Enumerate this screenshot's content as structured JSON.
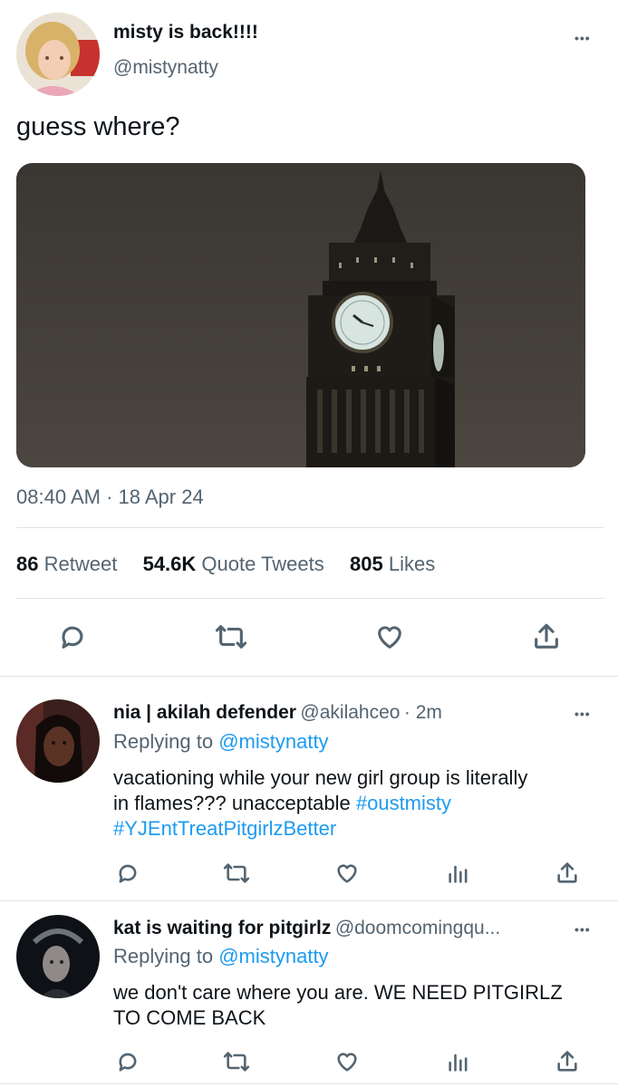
{
  "main_tweet": {
    "display_name": "misty is back!!!!",
    "handle": "@mistynatty",
    "text": "guess where?",
    "timestamp": "08:40 AM · 18 Apr 24",
    "stats": {
      "retweets_count": "86",
      "retweets_label": "Retweet",
      "quotes_count": "54.6K",
      "quotes_label": "Quote Tweets",
      "likes_count": "805",
      "likes_label": "Likes"
    }
  },
  "replies": [
    {
      "display_name": "nia | akilah defender",
      "handle": "@akilahceo",
      "time": "· 2m",
      "replying_to_label": "Replying to",
      "replying_to_handle": "@mistynatty",
      "text_line1": "vacationing while your new girl group is literally",
      "text_line2_plain": "in flames??? unacceptable ",
      "hashtag1": "#oustmisty",
      "hashtag2": "#YJEntTreatPitgirlzBetter"
    },
    {
      "display_name": "kat is waiting for pitgirlz",
      "handle": "@doomcomingqu...",
      "replying_to_label": "Replying to",
      "replying_to_handle": "@mistynatty",
      "text_line1": "we don't care where you are. WE NEED PITGIRLZ",
      "text_line2": "TO COME BACK"
    }
  ],
  "more_glyph": "•••",
  "colors": {
    "link": "#1d9bf0",
    "muted": "#536471",
    "text": "#0f1419",
    "divider": "#dfe3e6"
  }
}
